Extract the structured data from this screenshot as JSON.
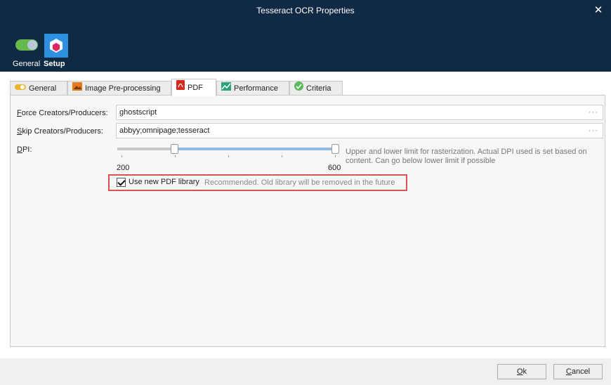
{
  "window": {
    "title": "Tesseract OCR Properties",
    "close_glyph": "✕"
  },
  "modes": [
    {
      "label": "General",
      "icon": "toggle-icon"
    },
    {
      "label": "Setup",
      "icon": "cube-icon",
      "selected": true
    }
  ],
  "tabs": [
    {
      "label": "General",
      "icon": "general-icon"
    },
    {
      "label": "Image Pre-processing",
      "icon": "image-icon"
    },
    {
      "label": "PDF",
      "icon": "pdf-icon",
      "active": true
    },
    {
      "label": "Performance",
      "icon": "performance-icon"
    },
    {
      "label": "Criteria",
      "icon": "check-icon"
    }
  ],
  "fields": {
    "force": {
      "label_hotkey": "F",
      "label_rest": "orce Creators/Producers:",
      "value": "ghostscript",
      "more": "···"
    },
    "skip": {
      "label_hotkey": "S",
      "label_rest": "kip Creators/Producers:",
      "value": "abbyy;omnipage;tesseract",
      "more": "···"
    }
  },
  "dpi": {
    "label_hotkey": "D",
    "label_rest": "PI:",
    "min_label": "200",
    "max_label": "600",
    "min_value": 200,
    "max_value": 600,
    "hint": "Upper and lower limit for rasterization. Actual DPI used is set based on content. Can go below lower limit if possible"
  },
  "pdf_library": {
    "checked": true,
    "label": "Use new PDF library",
    "note": "Recommended. Old library will be removed in the future"
  },
  "buttons": {
    "ok_hotkey": "O",
    "ok_rest": "k",
    "cancel_hotkey": "C",
    "cancel_rest": "ancel"
  },
  "colors": {
    "titlebar": "#102a43",
    "accent": "#2d8fe0",
    "highlight": "#d9534f"
  }
}
